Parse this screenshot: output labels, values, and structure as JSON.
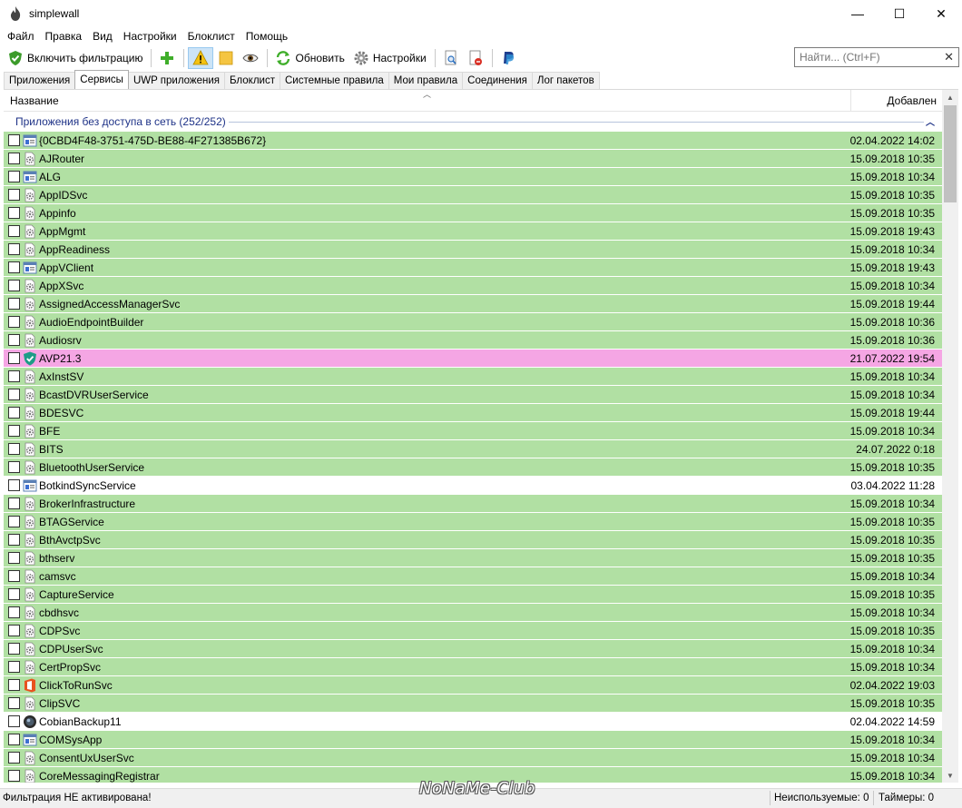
{
  "window": {
    "title": "simplewall",
    "controls": [
      "—",
      "☐",
      "✕"
    ]
  },
  "menu": [
    "Файл",
    "Правка",
    "Вид",
    "Настройки",
    "Блоклист",
    "Помощь"
  ],
  "toolbar": {
    "enable_filter": "Включить фильтрацию",
    "refresh": "Обновить",
    "settings": "Настройки"
  },
  "search": {
    "placeholder": "Найти... (Ctrl+F)"
  },
  "tabs": [
    "Приложения",
    "Сервисы",
    "UWP приложения",
    "Блоклист",
    "Системные правила",
    "Мои правила",
    "Соединения",
    "Лог пакетов"
  ],
  "selected_tab": 1,
  "columns": {
    "name": "Название",
    "added": "Добавлен"
  },
  "group": {
    "title": "Приложения без доступа в сеть (252/252)"
  },
  "colors": {
    "allowed": "#b1e0a3",
    "special": "#f5a6e4",
    "plain": "#ffffff",
    "group_text": "#1e3287"
  },
  "rows": [
    {
      "name": "{0CBD4F48-3751-475D-BE88-4F271385B672}",
      "date": "02.04.2022 14:02",
      "state": "allowed",
      "icon": "window-icon"
    },
    {
      "name": "AJRouter",
      "date": "15.09.2018 10:35",
      "state": "allowed",
      "icon": "service-icon"
    },
    {
      "name": "ALG",
      "date": "15.09.2018 10:34",
      "state": "allowed",
      "icon": "window-icon"
    },
    {
      "name": "AppIDSvc",
      "date": "15.09.2018 10:35",
      "state": "allowed",
      "icon": "service-icon"
    },
    {
      "name": "Appinfo",
      "date": "15.09.2018 10:35",
      "state": "allowed",
      "icon": "service-icon"
    },
    {
      "name": "AppMgmt",
      "date": "15.09.2018 19:43",
      "state": "allowed",
      "icon": "service-icon"
    },
    {
      "name": "AppReadiness",
      "date": "15.09.2018 10:34",
      "state": "allowed",
      "icon": "service-icon"
    },
    {
      "name": "AppVClient",
      "date": "15.09.2018 19:43",
      "state": "allowed",
      "icon": "window-icon"
    },
    {
      "name": "AppXSvc",
      "date": "15.09.2018 10:34",
      "state": "allowed",
      "icon": "service-icon"
    },
    {
      "name": "AssignedAccessManagerSvc",
      "date": "15.09.2018 19:44",
      "state": "allowed",
      "icon": "service-icon"
    },
    {
      "name": "AudioEndpointBuilder",
      "date": "15.09.2018 10:36",
      "state": "allowed",
      "icon": "service-icon"
    },
    {
      "name": "Audiosrv",
      "date": "15.09.2018 10:36",
      "state": "allowed",
      "icon": "service-icon"
    },
    {
      "name": "AVP21.3",
      "date": "21.07.2022 19:54",
      "state": "special",
      "icon": "shield-icon"
    },
    {
      "name": "AxInstSV",
      "date": "15.09.2018 10:34",
      "state": "allowed",
      "icon": "service-icon"
    },
    {
      "name": "BcastDVRUserService",
      "date": "15.09.2018 10:34",
      "state": "allowed",
      "icon": "service-icon"
    },
    {
      "name": "BDESVC",
      "date": "15.09.2018 19:44",
      "state": "allowed",
      "icon": "service-icon"
    },
    {
      "name": "BFE",
      "date": "15.09.2018 10:34",
      "state": "allowed",
      "icon": "service-icon"
    },
    {
      "name": "BITS",
      "date": "24.07.2022 0:18",
      "state": "allowed",
      "icon": "service-icon"
    },
    {
      "name": "BluetoothUserService",
      "date": "15.09.2018 10:35",
      "state": "allowed",
      "icon": "service-icon"
    },
    {
      "name": "BotkindSyncService",
      "date": "03.04.2022 11:28",
      "state": "plain",
      "icon": "window-icon"
    },
    {
      "name": "BrokerInfrastructure",
      "date": "15.09.2018 10:34",
      "state": "allowed",
      "icon": "service-icon"
    },
    {
      "name": "BTAGService",
      "date": "15.09.2018 10:35",
      "state": "allowed",
      "icon": "service-icon"
    },
    {
      "name": "BthAvctpSvc",
      "date": "15.09.2018 10:35",
      "state": "allowed",
      "icon": "service-icon"
    },
    {
      "name": "bthserv",
      "date": "15.09.2018 10:35",
      "state": "allowed",
      "icon": "service-icon"
    },
    {
      "name": "camsvc",
      "date": "15.09.2018 10:34",
      "state": "allowed",
      "icon": "service-icon"
    },
    {
      "name": "CaptureService",
      "date": "15.09.2018 10:35",
      "state": "allowed",
      "icon": "service-icon"
    },
    {
      "name": "cbdhsvc",
      "date": "15.09.2018 10:34",
      "state": "allowed",
      "icon": "service-icon"
    },
    {
      "name": "CDPSvc",
      "date": "15.09.2018 10:35",
      "state": "allowed",
      "icon": "service-icon"
    },
    {
      "name": "CDPUserSvc",
      "date": "15.09.2018 10:34",
      "state": "allowed",
      "icon": "service-icon"
    },
    {
      "name": "CertPropSvc",
      "date": "15.09.2018 10:34",
      "state": "allowed",
      "icon": "service-icon"
    },
    {
      "name": "ClickToRunSvc",
      "date": "02.04.2022 19:03",
      "state": "allowed",
      "icon": "office-icon"
    },
    {
      "name": "ClipSVC",
      "date": "15.09.2018 10:35",
      "state": "allowed",
      "icon": "service-icon"
    },
    {
      "name": "CobianBackup11",
      "date": "02.04.2022 14:59",
      "state": "plain",
      "icon": "backup-icon"
    },
    {
      "name": "COMSysApp",
      "date": "15.09.2018 10:34",
      "state": "allowed",
      "icon": "window-icon"
    },
    {
      "name": "ConsentUxUserSvc",
      "date": "15.09.2018 10:34",
      "state": "allowed",
      "icon": "service-icon"
    },
    {
      "name": "CoreMessagingRegistrar",
      "date": "15.09.2018 10:34",
      "state": "allowed",
      "icon": "service-icon"
    }
  ],
  "status": {
    "left": "Фильтрация НЕ активирована!",
    "unused": "Неиспользуемые: 0",
    "timers": "Таймеры: 0"
  },
  "watermark": "NoNaMe-Club"
}
